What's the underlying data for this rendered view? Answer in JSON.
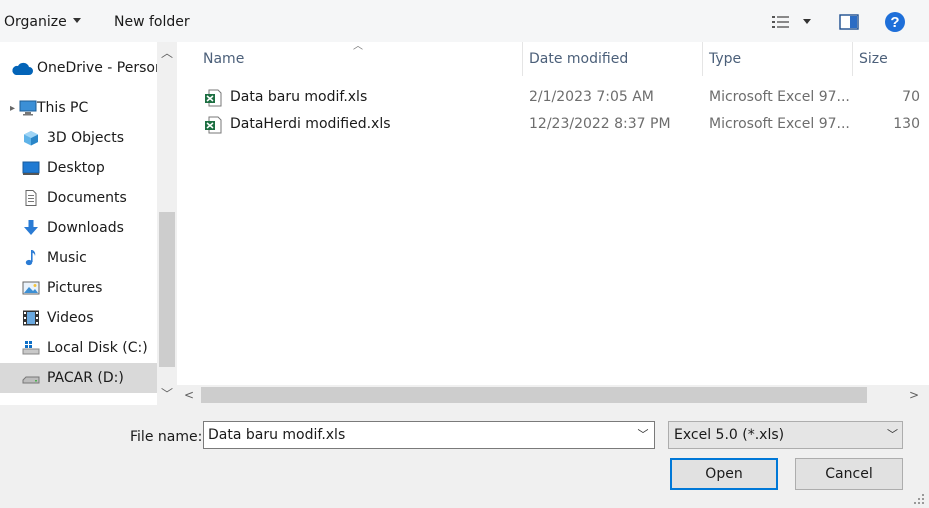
{
  "toolbar": {
    "organize_label": "Organize",
    "new_folder_label": "New folder"
  },
  "nav": {
    "items": [
      {
        "label": "OneDrive - Personal",
        "icon": "cloud-icon"
      },
      {
        "label": "This PC",
        "icon": "computer-icon"
      },
      {
        "label": "3D Objects",
        "icon": "cube-icon"
      },
      {
        "label": "Desktop",
        "icon": "desktop-icon"
      },
      {
        "label": "Documents",
        "icon": "document-icon"
      },
      {
        "label": "Downloads",
        "icon": "download-arrow-icon"
      },
      {
        "label": "Music",
        "icon": "music-note-icon"
      },
      {
        "label": "Pictures",
        "icon": "picture-icon"
      },
      {
        "label": "Videos",
        "icon": "film-icon"
      },
      {
        "label": "Local Disk (C:)",
        "icon": "drive-icon"
      },
      {
        "label": "PACAR (D:)",
        "icon": "drive-icon"
      }
    ],
    "selected": "PACAR (D:)"
  },
  "columns": {
    "name": "Name",
    "date": "Date modified",
    "type": "Type",
    "size": "Size"
  },
  "files": [
    {
      "name": "Data baru modif.xls",
      "date": "2/1/2023 7:05 AM",
      "type": "Microsoft Excel 97...",
      "size": "70"
    },
    {
      "name": "DataHerdi modified.xls",
      "date": "12/23/2022 8:37 PM",
      "type": "Microsoft Excel 97...",
      "size": "130"
    }
  ],
  "footer": {
    "file_name_label": "File name:",
    "file_name_value": "Data baru modif.xls",
    "file_type_value": "Excel 5.0 (*.xls)",
    "open_label": "Open",
    "cancel_label": "Cancel"
  },
  "colors": {
    "accent": "#0078d7",
    "excel_green": "#1d6f42",
    "onedrive_blue": "#0364b8"
  }
}
